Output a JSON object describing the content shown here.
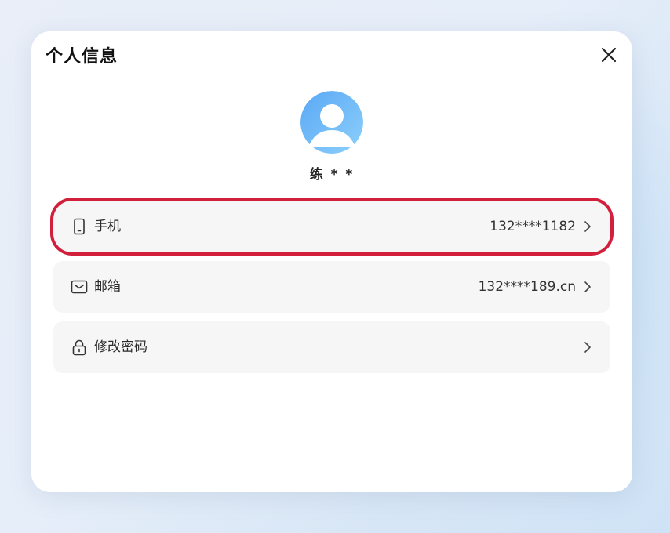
{
  "dialog": {
    "title": "个人信息",
    "close_icon": "close-icon"
  },
  "profile": {
    "avatar_icon": "user-avatar-icon",
    "avatar_color": "#6fb6f7",
    "name": "练 * *"
  },
  "rows": [
    {
      "icon": "phone-icon",
      "label": "手机",
      "value": "132****1182",
      "chevron_icon": "chevron-right-icon",
      "highlighted": true
    },
    {
      "icon": "mail-icon",
      "label": "邮箱",
      "value": "132****189.cn",
      "chevron_icon": "chevron-right-icon",
      "highlighted": false
    },
    {
      "icon": "lock-icon",
      "label": "修改密码",
      "value": "",
      "chevron_icon": "chevron-right-icon",
      "highlighted": false
    }
  ],
  "colors": {
    "highlight_border": "#d11f3c",
    "row_background": "#f6f6f7"
  }
}
